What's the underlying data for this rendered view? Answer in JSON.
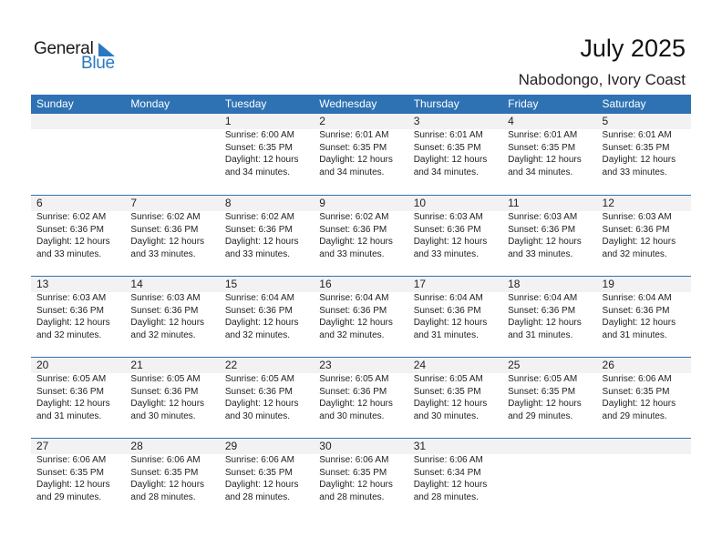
{
  "logo": {
    "general": "General",
    "blue": "Blue"
  },
  "header": {
    "title": "July 2025",
    "location": "Nabodongo, Ivory Coast"
  },
  "colors": {
    "accent": "#2e72b4",
    "band": "#f2f2f2",
    "logo_blue": "#2a78c2"
  },
  "weekdays": [
    "Sunday",
    "Monday",
    "Tuesday",
    "Wednesday",
    "Thursday",
    "Friday",
    "Saturday"
  ],
  "weeks": [
    [
      {
        "day": "",
        "sunrise": "",
        "sunset": "",
        "daylight": "",
        "minutes": ""
      },
      {
        "day": "",
        "sunrise": "",
        "sunset": "",
        "daylight": "",
        "minutes": ""
      },
      {
        "day": "1",
        "sunrise": "Sunrise: 6:00 AM",
        "sunset": "Sunset: 6:35 PM",
        "daylight": "Daylight: 12 hours",
        "minutes": "and 34 minutes."
      },
      {
        "day": "2",
        "sunrise": "Sunrise: 6:01 AM",
        "sunset": "Sunset: 6:35 PM",
        "daylight": "Daylight: 12 hours",
        "minutes": "and 34 minutes."
      },
      {
        "day": "3",
        "sunrise": "Sunrise: 6:01 AM",
        "sunset": "Sunset: 6:35 PM",
        "daylight": "Daylight: 12 hours",
        "minutes": "and 34 minutes."
      },
      {
        "day": "4",
        "sunrise": "Sunrise: 6:01 AM",
        "sunset": "Sunset: 6:35 PM",
        "daylight": "Daylight: 12 hours",
        "minutes": "and 34 minutes."
      },
      {
        "day": "5",
        "sunrise": "Sunrise: 6:01 AM",
        "sunset": "Sunset: 6:35 PM",
        "daylight": "Daylight: 12 hours",
        "minutes": "and 33 minutes."
      }
    ],
    [
      {
        "day": "6",
        "sunrise": "Sunrise: 6:02 AM",
        "sunset": "Sunset: 6:36 PM",
        "daylight": "Daylight: 12 hours",
        "minutes": "and 33 minutes."
      },
      {
        "day": "7",
        "sunrise": "Sunrise: 6:02 AM",
        "sunset": "Sunset: 6:36 PM",
        "daylight": "Daylight: 12 hours",
        "minutes": "and 33 minutes."
      },
      {
        "day": "8",
        "sunrise": "Sunrise: 6:02 AM",
        "sunset": "Sunset: 6:36 PM",
        "daylight": "Daylight: 12 hours",
        "minutes": "and 33 minutes."
      },
      {
        "day": "9",
        "sunrise": "Sunrise: 6:02 AM",
        "sunset": "Sunset: 6:36 PM",
        "daylight": "Daylight: 12 hours",
        "minutes": "and 33 minutes."
      },
      {
        "day": "10",
        "sunrise": "Sunrise: 6:03 AM",
        "sunset": "Sunset: 6:36 PM",
        "daylight": "Daylight: 12 hours",
        "minutes": "and 33 minutes."
      },
      {
        "day": "11",
        "sunrise": "Sunrise: 6:03 AM",
        "sunset": "Sunset: 6:36 PM",
        "daylight": "Daylight: 12 hours",
        "minutes": "and 33 minutes."
      },
      {
        "day": "12",
        "sunrise": "Sunrise: 6:03 AM",
        "sunset": "Sunset: 6:36 PM",
        "daylight": "Daylight: 12 hours",
        "minutes": "and 32 minutes."
      }
    ],
    [
      {
        "day": "13",
        "sunrise": "Sunrise: 6:03 AM",
        "sunset": "Sunset: 6:36 PM",
        "daylight": "Daylight: 12 hours",
        "minutes": "and 32 minutes."
      },
      {
        "day": "14",
        "sunrise": "Sunrise: 6:03 AM",
        "sunset": "Sunset: 6:36 PM",
        "daylight": "Daylight: 12 hours",
        "minutes": "and 32 minutes."
      },
      {
        "day": "15",
        "sunrise": "Sunrise: 6:04 AM",
        "sunset": "Sunset: 6:36 PM",
        "daylight": "Daylight: 12 hours",
        "minutes": "and 32 minutes."
      },
      {
        "day": "16",
        "sunrise": "Sunrise: 6:04 AM",
        "sunset": "Sunset: 6:36 PM",
        "daylight": "Daylight: 12 hours",
        "minutes": "and 32 minutes."
      },
      {
        "day": "17",
        "sunrise": "Sunrise: 6:04 AM",
        "sunset": "Sunset: 6:36 PM",
        "daylight": "Daylight: 12 hours",
        "minutes": "and 31 minutes."
      },
      {
        "day": "18",
        "sunrise": "Sunrise: 6:04 AM",
        "sunset": "Sunset: 6:36 PM",
        "daylight": "Daylight: 12 hours",
        "minutes": "and 31 minutes."
      },
      {
        "day": "19",
        "sunrise": "Sunrise: 6:04 AM",
        "sunset": "Sunset: 6:36 PM",
        "daylight": "Daylight: 12 hours",
        "minutes": "and 31 minutes."
      }
    ],
    [
      {
        "day": "20",
        "sunrise": "Sunrise: 6:05 AM",
        "sunset": "Sunset: 6:36 PM",
        "daylight": "Daylight: 12 hours",
        "minutes": "and 31 minutes."
      },
      {
        "day": "21",
        "sunrise": "Sunrise: 6:05 AM",
        "sunset": "Sunset: 6:36 PM",
        "daylight": "Daylight: 12 hours",
        "minutes": "and 30 minutes."
      },
      {
        "day": "22",
        "sunrise": "Sunrise: 6:05 AM",
        "sunset": "Sunset: 6:36 PM",
        "daylight": "Daylight: 12 hours",
        "minutes": "and 30 minutes."
      },
      {
        "day": "23",
        "sunrise": "Sunrise: 6:05 AM",
        "sunset": "Sunset: 6:36 PM",
        "daylight": "Daylight: 12 hours",
        "minutes": "and 30 minutes."
      },
      {
        "day": "24",
        "sunrise": "Sunrise: 6:05 AM",
        "sunset": "Sunset: 6:35 PM",
        "daylight": "Daylight: 12 hours",
        "minutes": "and 30 minutes."
      },
      {
        "day": "25",
        "sunrise": "Sunrise: 6:05 AM",
        "sunset": "Sunset: 6:35 PM",
        "daylight": "Daylight: 12 hours",
        "minutes": "and 29 minutes."
      },
      {
        "day": "26",
        "sunrise": "Sunrise: 6:06 AM",
        "sunset": "Sunset: 6:35 PM",
        "daylight": "Daylight: 12 hours",
        "minutes": "and 29 minutes."
      }
    ],
    [
      {
        "day": "27",
        "sunrise": "Sunrise: 6:06 AM",
        "sunset": "Sunset: 6:35 PM",
        "daylight": "Daylight: 12 hours",
        "minutes": "and 29 minutes."
      },
      {
        "day": "28",
        "sunrise": "Sunrise: 6:06 AM",
        "sunset": "Sunset: 6:35 PM",
        "daylight": "Daylight: 12 hours",
        "minutes": "and 28 minutes."
      },
      {
        "day": "29",
        "sunrise": "Sunrise: 6:06 AM",
        "sunset": "Sunset: 6:35 PM",
        "daylight": "Daylight: 12 hours",
        "minutes": "and 28 minutes."
      },
      {
        "day": "30",
        "sunrise": "Sunrise: 6:06 AM",
        "sunset": "Sunset: 6:35 PM",
        "daylight": "Daylight: 12 hours",
        "minutes": "and 28 minutes."
      },
      {
        "day": "31",
        "sunrise": "Sunrise: 6:06 AM",
        "sunset": "Sunset: 6:34 PM",
        "daylight": "Daylight: 12 hours",
        "minutes": "and 28 minutes."
      },
      {
        "day": "",
        "sunrise": "",
        "sunset": "",
        "daylight": "",
        "minutes": ""
      },
      {
        "day": "",
        "sunrise": "",
        "sunset": "",
        "daylight": "",
        "minutes": ""
      }
    ]
  ]
}
